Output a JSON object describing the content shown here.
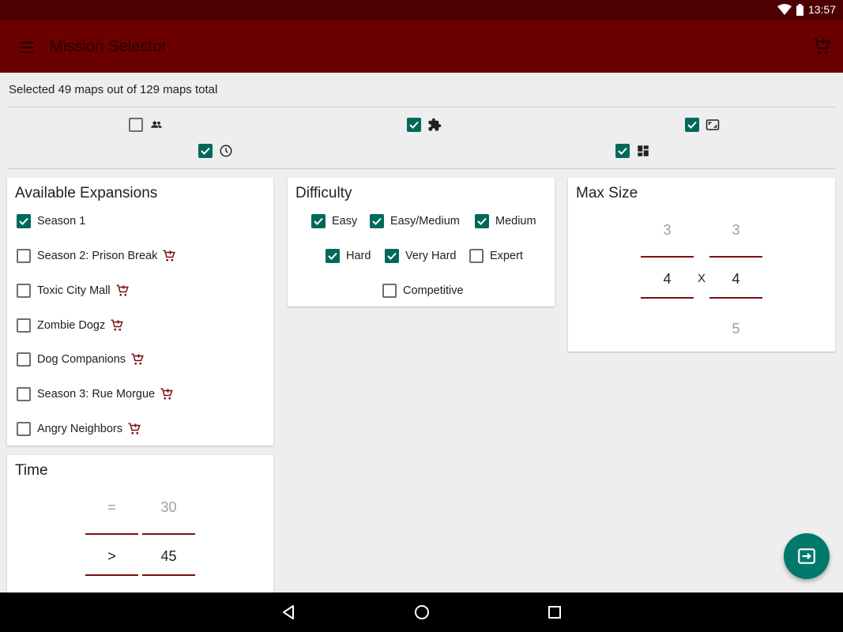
{
  "status_bar": {
    "time": "13:57"
  },
  "app_bar": {
    "title": "Mission Selector",
    "menu_icon": "hamburger-menu-icon",
    "cart_icon": "add-shopping-cart-icon"
  },
  "summary": "Selected 49 maps out of 129 maps total",
  "filter_toggles": [
    {
      "icon": "group-icon",
      "checked": false
    },
    {
      "icon": "puzzle-extension-icon",
      "checked": true
    },
    {
      "icon": "aspect-ratio-icon",
      "checked": true
    },
    {
      "icon": "clock-icon",
      "checked": true
    },
    {
      "icon": "dashboard-tiles-icon",
      "checked": true
    }
  ],
  "expansions": {
    "title": "Available Expansions",
    "items": [
      {
        "label": "Season 1",
        "checked": true,
        "purchasable": false
      },
      {
        "label": "Season 2: Prison Break",
        "checked": false,
        "purchasable": true
      },
      {
        "label": "Toxic City Mall",
        "checked": false,
        "purchasable": true
      },
      {
        "label": "Zombie Dogz",
        "checked": false,
        "purchasable": true
      },
      {
        "label": "Dog Companions",
        "checked": false,
        "purchasable": true
      },
      {
        "label": "Season 3: Rue Morgue",
        "checked": false,
        "purchasable": true
      },
      {
        "label": "Angry Neighbors",
        "checked": false,
        "purchasable": true
      }
    ]
  },
  "difficulty": {
    "title": "Difficulty",
    "items": [
      {
        "label": "Easy",
        "checked": true
      },
      {
        "label": "Easy/Medium",
        "checked": true
      },
      {
        "label": "Medium",
        "checked": true
      },
      {
        "label": "Hard",
        "checked": true
      },
      {
        "label": "Very Hard",
        "checked": true
      },
      {
        "label": "Expert",
        "checked": false
      },
      {
        "label": "Competitive",
        "checked": false
      }
    ]
  },
  "max_size": {
    "title": "Max Size",
    "width_picker": {
      "above": "3",
      "selected": "4",
      "below": ""
    },
    "separator": "X",
    "height_picker": {
      "above": "3",
      "selected": "4",
      "below": "5"
    }
  },
  "time": {
    "title": "Time",
    "operator_picker": {
      "above": "=",
      "selected": ">"
    },
    "value_picker": {
      "above": "30",
      "selected": "45"
    }
  },
  "fab": {
    "icon": "exit-to-app-icon"
  },
  "colors": {
    "app_bar": "#6b0000",
    "status_bar": "#4d0000",
    "accent": "#00695c",
    "fab": "#00796b",
    "cart": "#7a1010"
  }
}
